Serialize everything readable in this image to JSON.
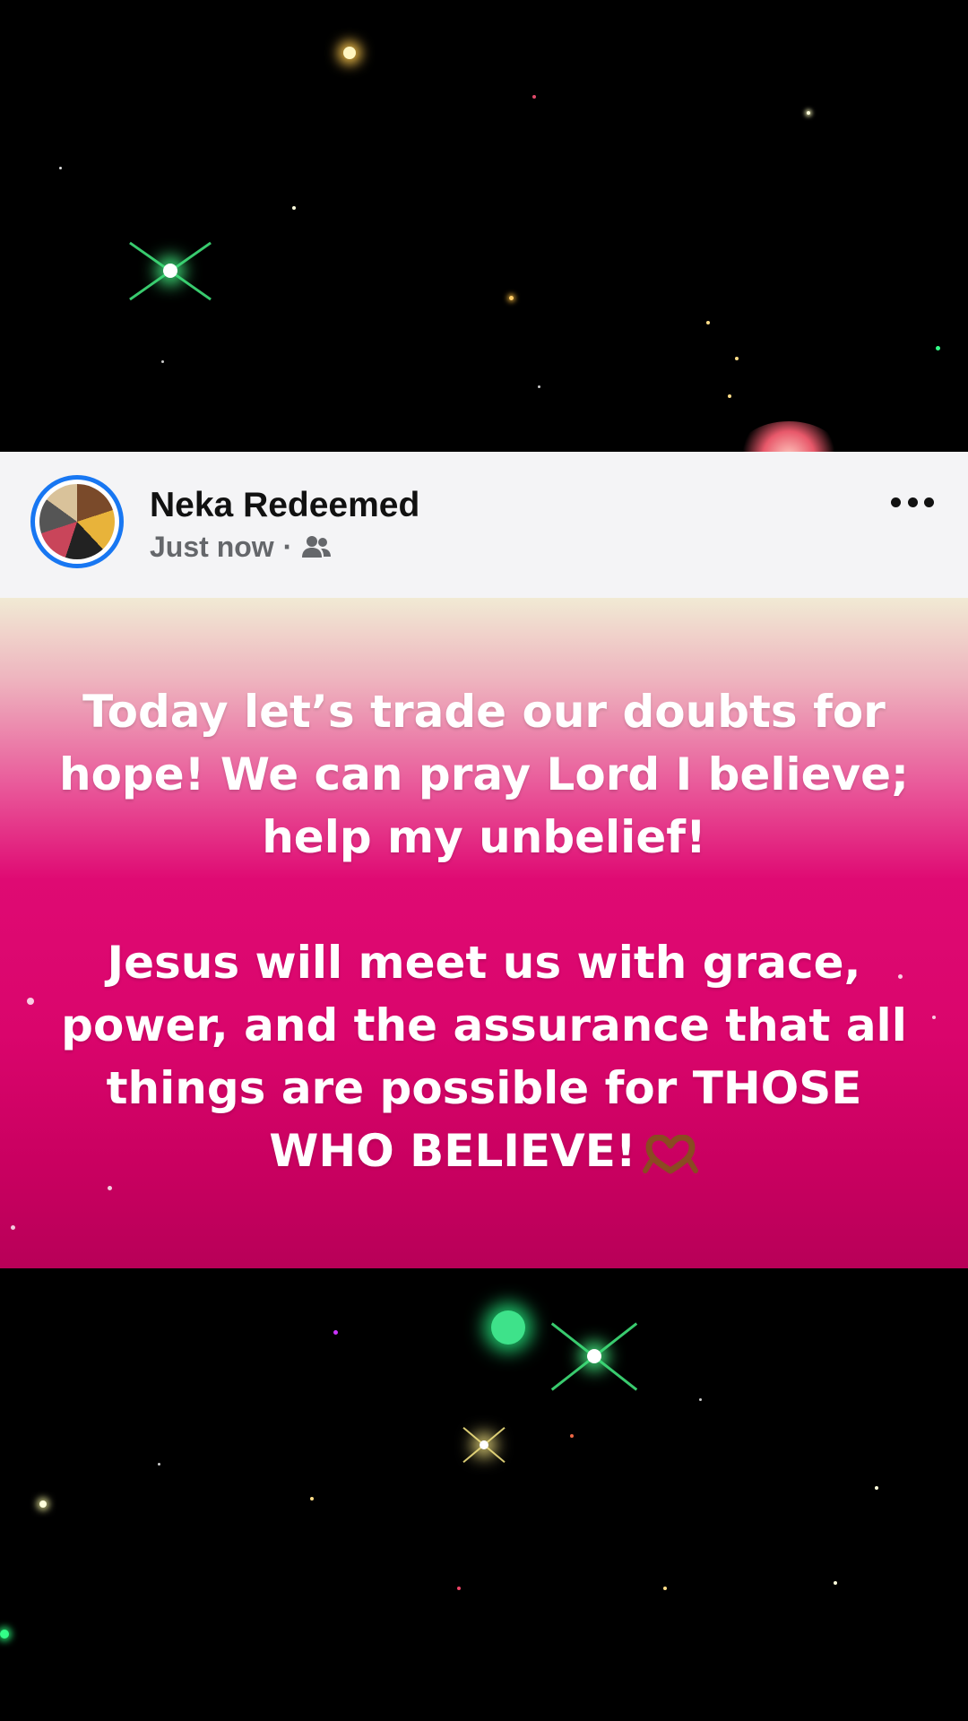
{
  "post": {
    "author": "Neka Redeemed",
    "timestamp": "Just now",
    "separator": "·",
    "audience_icon": "friends-icon",
    "more_icon": "more-options-icon",
    "text_paragraph_1": "Today let’s trade our doubts for hope! We can pray Lord I believe; help my unbelief!",
    "text_paragraph_2": "Jesus will meet us with grace, power, and the assurance that all things are possible for THOSE WHO BELIEVE!",
    "emoji": "heart-hands-emoji"
  },
  "colors": {
    "header_bg": "#f4f4f6",
    "avatar_ring": "#1877f2",
    "name": "#111111",
    "meta": "#65676b",
    "gradient_top": "#f1ead4",
    "gradient_mid": "#df0a73",
    "gradient_bottom": "#b80058",
    "background": "#000000"
  }
}
